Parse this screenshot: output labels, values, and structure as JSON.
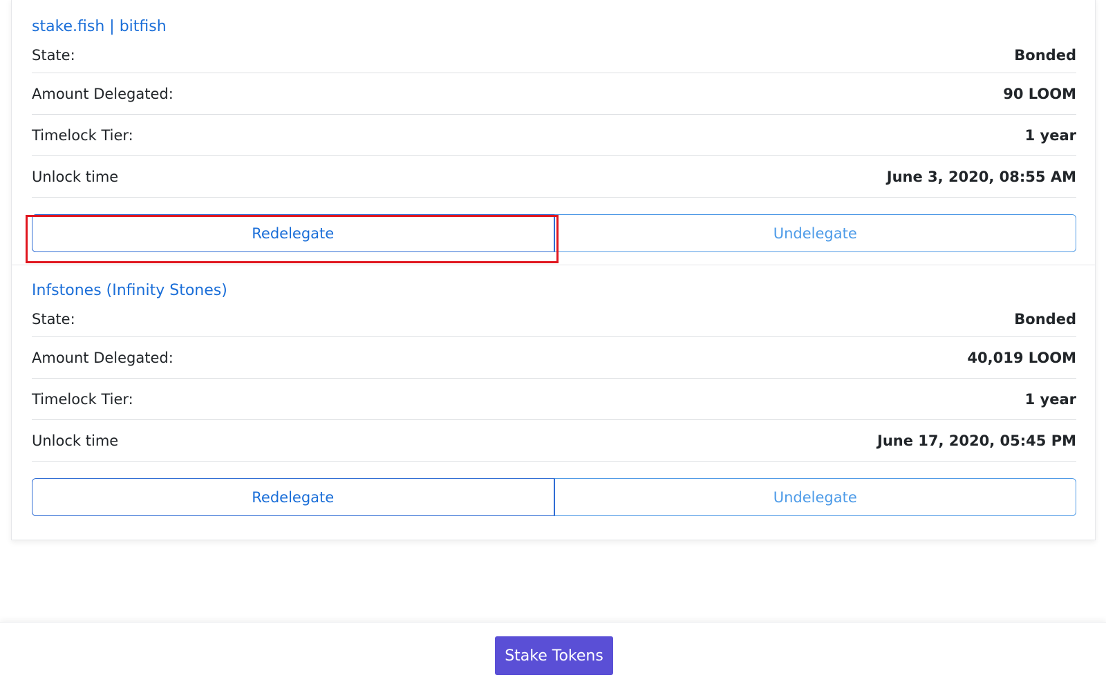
{
  "delegations": [
    {
      "validator_name": "stake.fish | bitfish",
      "rows": [
        {
          "label": "State:",
          "value": "Bonded"
        },
        {
          "label": "Amount Delegated:",
          "value": "90 LOOM"
        },
        {
          "label": "Timelock Tier:",
          "value": "1 year"
        },
        {
          "label": "Unlock time",
          "value": "June 3, 2020, 08:55 AM"
        }
      ],
      "redelegate_label": "Redelegate",
      "undelegate_label": "Undelegate"
    },
    {
      "validator_name": "Infstones (Infinity Stones)",
      "rows": [
        {
          "label": "State:",
          "value": "Bonded"
        },
        {
          "label": "Amount Delegated:",
          "value": "40,019 LOOM"
        },
        {
          "label": "Timelock Tier:",
          "value": "1 year"
        },
        {
          "label": "Unlock time",
          "value": "June 17, 2020, 05:45 PM"
        }
      ],
      "redelegate_label": "Redelegate",
      "undelegate_label": "Undelegate"
    }
  ],
  "footer": {
    "stake_button_label": "Stake Tokens"
  },
  "colors": {
    "link": "#1a6ed8",
    "button_border": "#2f6cd4",
    "primary": "#5a4fd6",
    "highlight": "#e0161f"
  }
}
